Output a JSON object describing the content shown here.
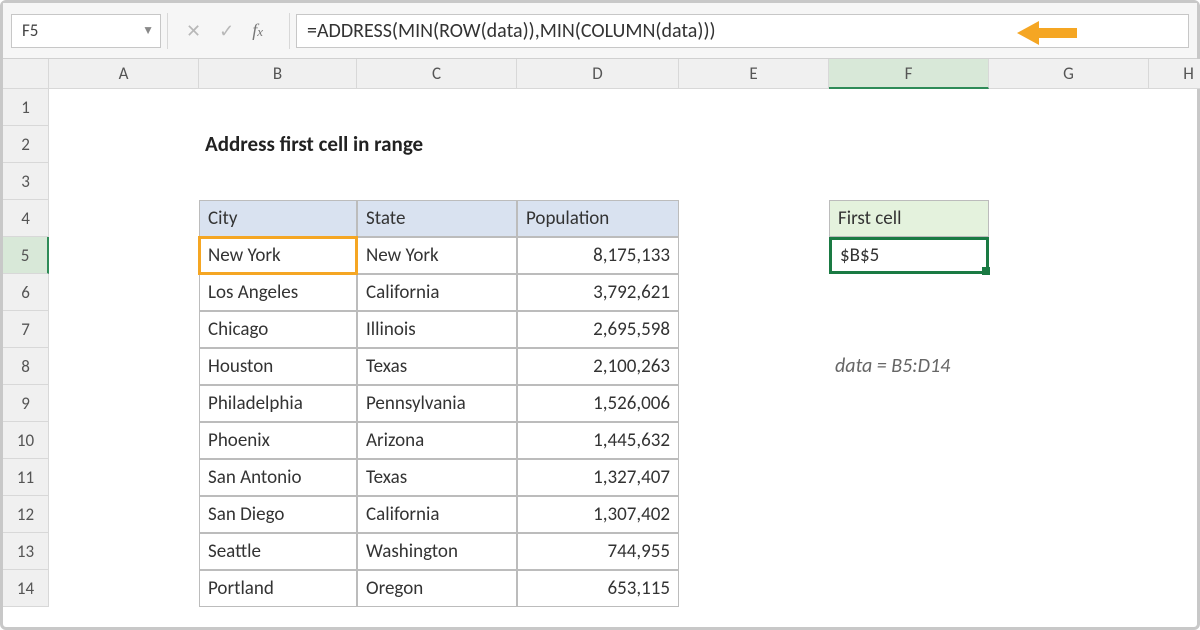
{
  "formula_bar": {
    "cell_ref": "F5",
    "formula": "=ADDRESS(MIN(ROW(data)),MIN(COLUMN(data)))"
  },
  "columns": [
    "A",
    "B",
    "C",
    "D",
    "E",
    "F",
    "G",
    "H"
  ],
  "rows": [
    "1",
    "2",
    "3",
    "4",
    "5",
    "6",
    "7",
    "8",
    "9",
    "10",
    "11",
    "12",
    "13",
    "14"
  ],
  "title": "Address first cell in range",
  "table": {
    "headers": {
      "city": "City",
      "state": "State",
      "pop": "Population"
    },
    "rows": [
      {
        "city": "New York",
        "state": "New York",
        "pop": "8,175,133"
      },
      {
        "city": "Los Angeles",
        "state": "California",
        "pop": "3,792,621"
      },
      {
        "city": "Chicago",
        "state": "Illinois",
        "pop": "2,695,598"
      },
      {
        "city": "Houston",
        "state": "Texas",
        "pop": "2,100,263"
      },
      {
        "city": "Philadelphia",
        "state": "Pennsylvania",
        "pop": "1,526,006"
      },
      {
        "city": "Phoenix",
        "state": "Arizona",
        "pop": "1,445,632"
      },
      {
        "city": "San Antonio",
        "state": "Texas",
        "pop": "1,327,407"
      },
      {
        "city": "San Diego",
        "state": "California",
        "pop": "1,307,402"
      },
      {
        "city": "Seattle",
        "state": "Washington",
        "pop": "744,955"
      },
      {
        "city": "Portland",
        "state": "Oregon",
        "pop": "653,115"
      }
    ]
  },
  "first_cell": {
    "label": "First cell",
    "value": "$B$5"
  },
  "note": "data = B5:D14",
  "active": {
    "col": "F",
    "row": "5"
  }
}
